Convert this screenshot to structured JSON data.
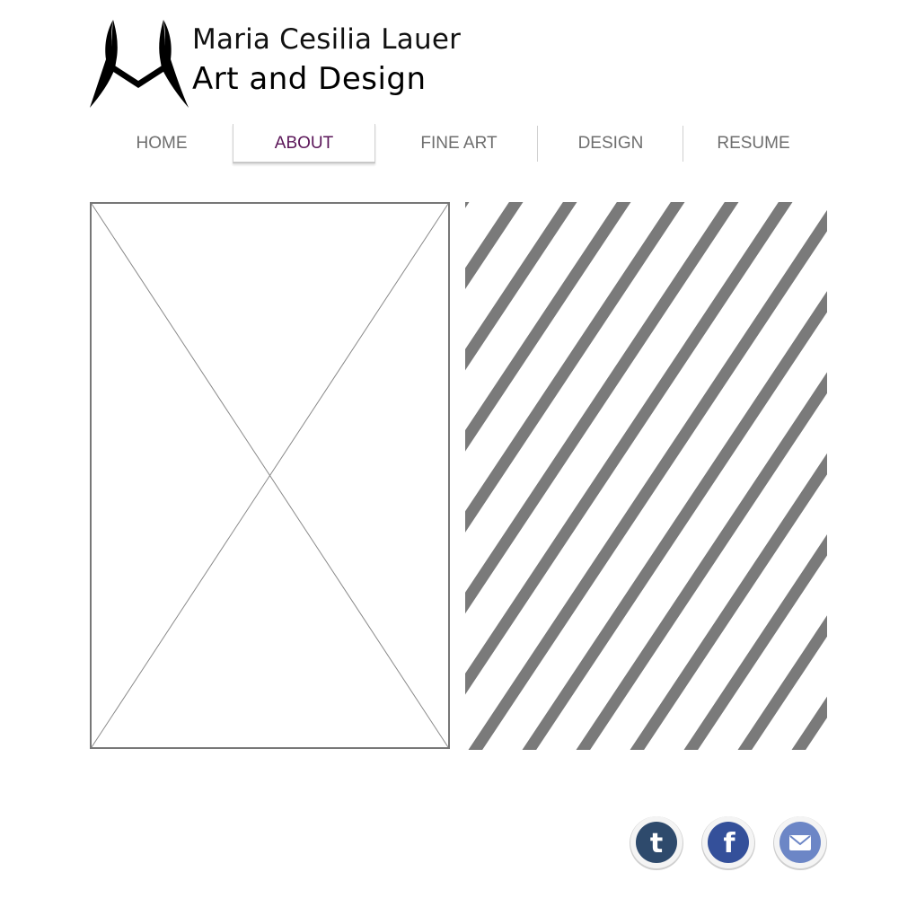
{
  "header": {
    "logo_icon": "mcl-monogram-logo",
    "brand_name": "Maria Cesilia Lauer",
    "brand_subtitle": "Art and Design"
  },
  "nav": {
    "items": [
      {
        "label": "HOME",
        "active": false
      },
      {
        "label": "ABOUT",
        "active": true
      },
      {
        "label": "FINE ART",
        "active": false
      },
      {
        "label": "DESIGN",
        "active": false
      },
      {
        "label": "RESUME",
        "active": false
      }
    ],
    "active_color": "#5a1558",
    "inactive_color": "#6e6e6e"
  },
  "content": {
    "image_placeholder_icon": "image-placeholder",
    "pattern_icon": "diagonal-stripes-pattern",
    "stripe_color": "#7a7a7a"
  },
  "social": {
    "items": [
      {
        "icon": "tumblr-icon",
        "glyph": "t",
        "color": "#2e4a6c"
      },
      {
        "icon": "facebook-icon",
        "glyph": "f",
        "color": "#34509a"
      },
      {
        "icon": "email-icon",
        "glyph": "",
        "color": "#6c86c6"
      }
    ]
  }
}
